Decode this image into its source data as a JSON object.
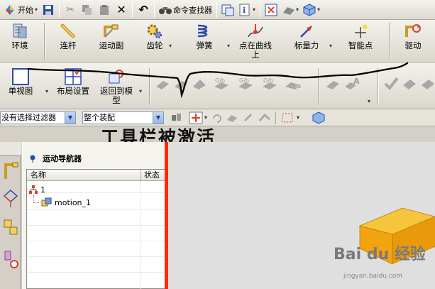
{
  "toolbar1": {
    "start_label": "开始",
    "command_finder_label": "命令查找器"
  },
  "motion_toolbar": {
    "environment": "环境",
    "link": "连杆",
    "motion_pair": "运动副",
    "gear": "齿轮",
    "spring": "弹簧",
    "point_on_curve": "点在曲线上",
    "scalar_force": "标量力",
    "smart_point": "智能点",
    "driver": "驱动"
  },
  "view_toolbar": {
    "single_view": "单视图",
    "layout_settings": "布局设置",
    "return_to_model": "返回到模型",
    "dropdown_glyph": "▾"
  },
  "selection_bar": {
    "filter_value": "没有选择过滤器",
    "scope_value": "整个装配"
  },
  "annotation": {
    "text": "工具栏被激活"
  },
  "navigator": {
    "title": "运动导航器",
    "col_name": "名称",
    "col_status": "状态",
    "root_label": "1",
    "child_label": "motion_1"
  },
  "watermark": {
    "brand": "Bai du 经验",
    "url": "jingyan.baidu.com"
  },
  "colors": {
    "splitter": "#ff2a00",
    "graphics_bg": "#dfdfdf",
    "block_top": "#f7c53c",
    "block_front": "#f2a310"
  }
}
